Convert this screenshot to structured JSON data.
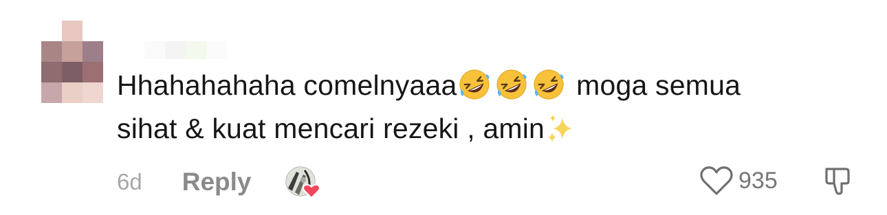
{
  "comment": {
    "text_before_emojis": "Hhahahahaha comelnyaaa",
    "emojis": [
      "rolling-on-floor-laughing",
      "rolling-on-floor-laughing",
      "rolling-on-floor-laughing"
    ],
    "text_line1_end": "moga semua",
    "text_line2": "sihat & kuat mencari rezeki , amin",
    "trailing_emoji": "sparkles"
  },
  "meta": {
    "time": "6d",
    "reply_label": "Reply"
  },
  "likes": {
    "count": "935"
  },
  "colors": {
    "text": "#161616",
    "muted": "#a7a7a7",
    "reply": "#8a8a8a",
    "heart_badge": "#f0475c"
  }
}
